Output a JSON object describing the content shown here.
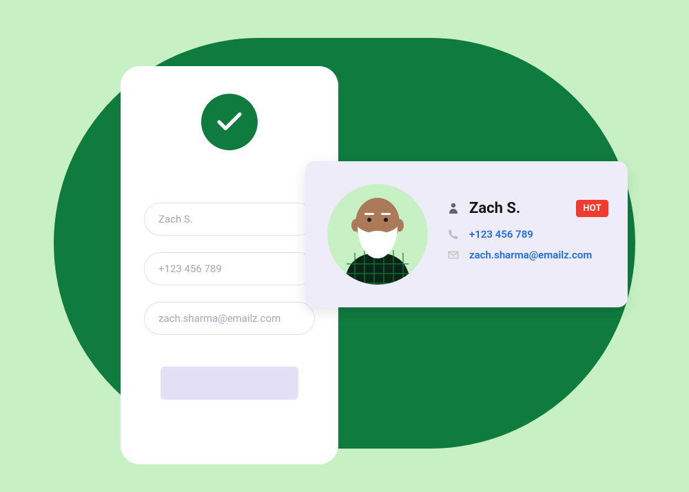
{
  "form": {
    "name": "Zach S.",
    "phone": "+123 456 789",
    "email": "zach.sharma@emailz.com"
  },
  "contact": {
    "name": "Zach S.",
    "phone": "+123 456 789",
    "email": "zach.sharma@emailz.com",
    "badge": "HOT"
  }
}
